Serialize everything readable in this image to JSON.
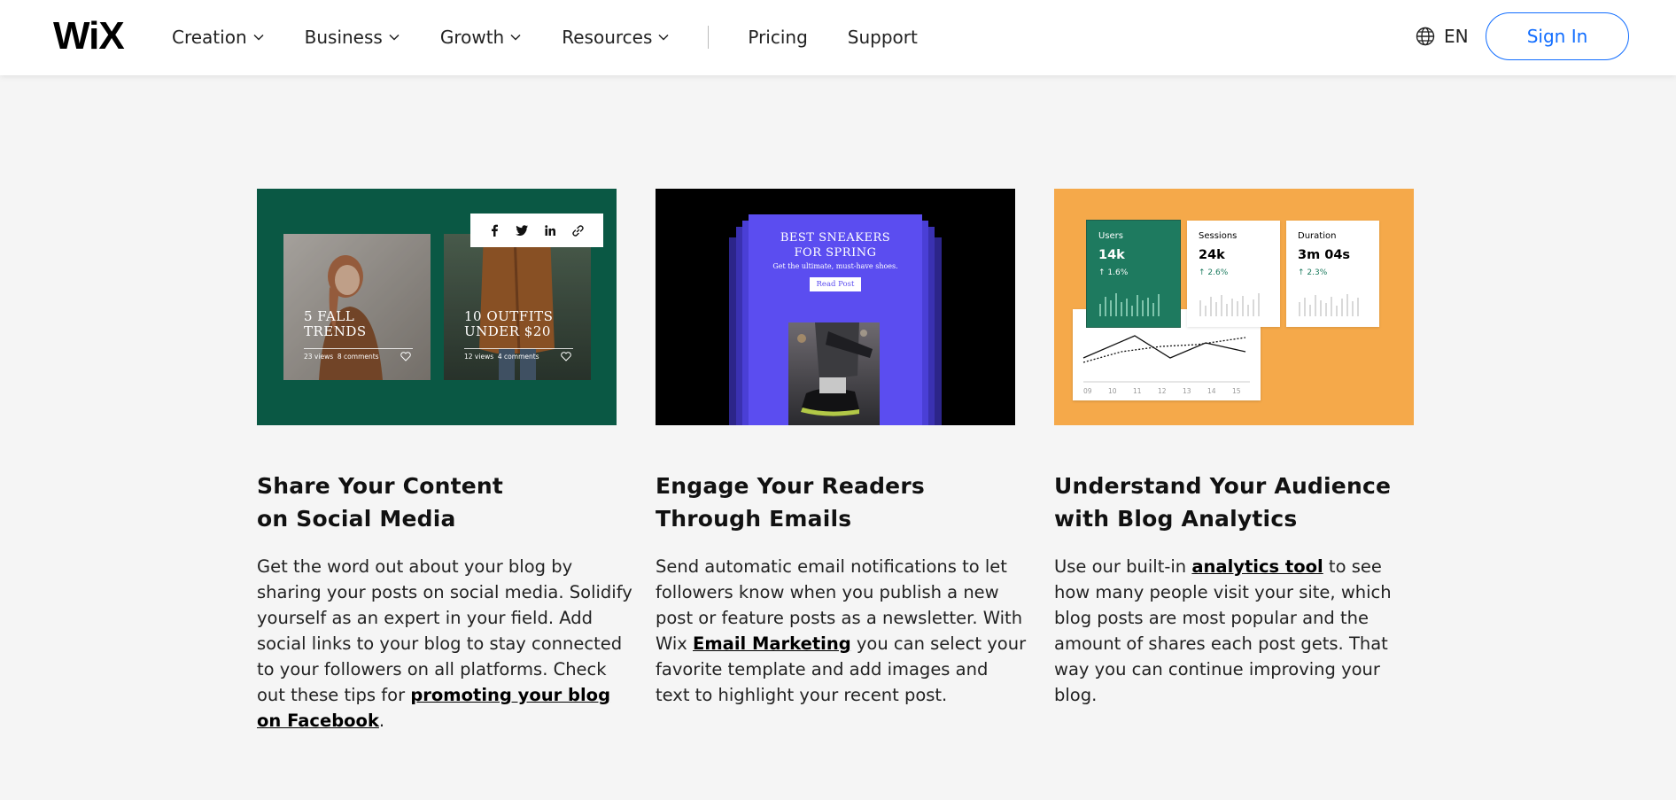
{
  "header": {
    "logo": "WiX",
    "nav": [
      {
        "label": "Creation"
      },
      {
        "label": "Business"
      },
      {
        "label": "Growth"
      },
      {
        "label": "Resources"
      }
    ],
    "links": [
      "Pricing",
      "Support"
    ],
    "language": "EN",
    "signin_label": "Sign In"
  },
  "features": [
    {
      "title_line1": "Share Your Content",
      "title_line2": "on Social Media",
      "desc_before": "Get the word out about your blog by sharing your posts on social media. Solidify yourself as an expert in your field. Add social links to your blog to stay connected to your followers on all platforms. Check out these tips for ",
      "link": "promoting your blog on Facebook",
      "desc_after": ".",
      "image": {
        "posts": [
          {
            "title_line1": "5 FALL",
            "title_line2": "TRENDS",
            "views": "23 views",
            "comments": "8 comments"
          },
          {
            "title_line1": "10 OUTFITS",
            "title_line2": "UNDER $20",
            "views": "12 views",
            "comments": "4 comments"
          }
        ],
        "share_icons": [
          "facebook-icon",
          "twitter-icon",
          "linkedin-icon",
          "link-icon"
        ]
      }
    },
    {
      "title_line1": "Engage Your Readers",
      "title_line2": "Through Emails",
      "desc_before": "Send automatic email notifications to let followers know when you publish a new post or feature posts as a newsletter. With Wix ",
      "link": "Email Marketing",
      "desc_after": " you can select your favorite template and add images and text to highlight your recent post.",
      "image": {
        "heading_line1": "BEST SNEAKERS",
        "heading_line2": "FOR SPRING",
        "subheading": "Get the ultimate, must-have shoes.",
        "button": "Read Post"
      }
    },
    {
      "title_line1": "Understand Your Audience",
      "title_line2": "with Blog Analytics",
      "desc_before": "Use our built-in ",
      "link": "analytics tool",
      "desc_after": " to see how many people visit your site, which blog posts are most popular and the amount of shares each post gets. That way you can continue improving your blog.",
      "image": {
        "stats": [
          {
            "label": "Users",
            "value": "14k",
            "change": "↑ 1.6%"
          },
          {
            "label": "Sessions",
            "value": "24k",
            "change": "↑ 2.6%"
          },
          {
            "label": "Duration",
            "value": "3m 04s",
            "change": "↑ 2.3%"
          }
        ],
        "x_ticks": [
          "09",
          "10",
          "11",
          "12",
          "13",
          "14",
          "15"
        ]
      }
    }
  ],
  "colors": {
    "accent": "#116dff",
    "card1_bg": "#0a5844",
    "card2_bg": "#000000",
    "email_purple": "#5b4df0",
    "card3_bg": "#f5a94a",
    "stat_green": "#1e7a5f"
  }
}
